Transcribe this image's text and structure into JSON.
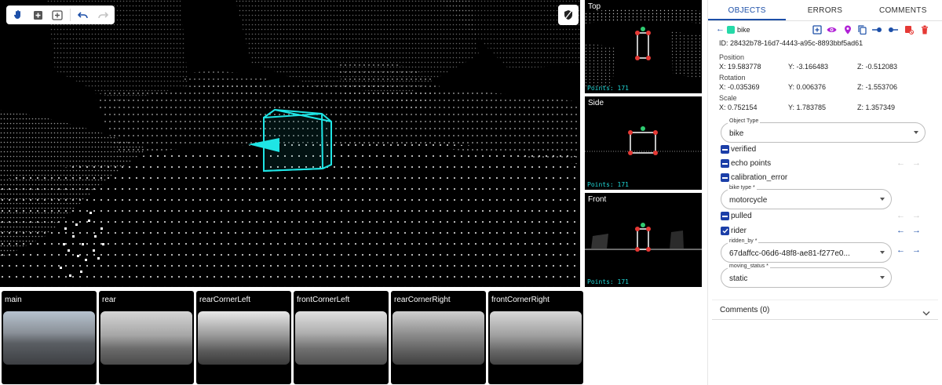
{
  "viewports": {
    "top": {
      "label": "Top",
      "points": "Points: 171"
    },
    "side": {
      "label": "Side",
      "points": "Points: 171"
    },
    "front": {
      "label": "Front",
      "points": "Points: 171"
    }
  },
  "toolbar": {
    "icons": [
      "hand-icon",
      "add-box-icon",
      "add-frame-icon",
      "undo-icon",
      "redo-icon"
    ]
  },
  "cameras": [
    {
      "label": "main"
    },
    {
      "label": "rear"
    },
    {
      "label": "rearCornerLeft"
    },
    {
      "label": "frontCornerLeft"
    },
    {
      "label": "rearCornerRight"
    },
    {
      "label": "frontCornerRight"
    }
  ],
  "panel": {
    "tabs": [
      "OBJECTS",
      "ERRORS",
      "COMMENTS"
    ],
    "object": {
      "name": "bike",
      "color": "#25d9a8",
      "id": "ID: 28432b78-16d7-4443-a95c-8893bbf5ad61"
    },
    "position": {
      "label": "Position",
      "x": "X: 19.583778",
      "y": "Y: -3.166483",
      "z": "Z: -0.512083"
    },
    "rotation": {
      "label": "Rotation",
      "x": "X: -0.035369",
      "y": "Y: 0.006376",
      "z": "Z: -1.553706"
    },
    "scale": {
      "label": "Scale",
      "x": "X: 0.752154",
      "y": "Y: 1.783785",
      "z": "Z: 1.357349"
    },
    "object_type": {
      "label": "Object Type",
      "value": "bike"
    },
    "attrs": {
      "verified": "verified",
      "echo_points": "echo points",
      "calibration_error": "calibration_error",
      "bike_type": {
        "label": "bike type *",
        "value": "motorcycle"
      },
      "pulled": "pulled",
      "rider": "rider",
      "ridden_by": {
        "label": "ridden_by *",
        "value": "67daffcc-06d6-48f8-ae81-f277e0..."
      },
      "moving_status": {
        "label": "moving_status *",
        "value": "static"
      }
    },
    "comments": {
      "title": "Comments (0)"
    }
  },
  "colors": {
    "accent": "#1c4fa8",
    "cuboid": "#1fe5e5",
    "points_text": "#20d8d8",
    "delete": "#e53935",
    "visibility": "#b021d6"
  }
}
